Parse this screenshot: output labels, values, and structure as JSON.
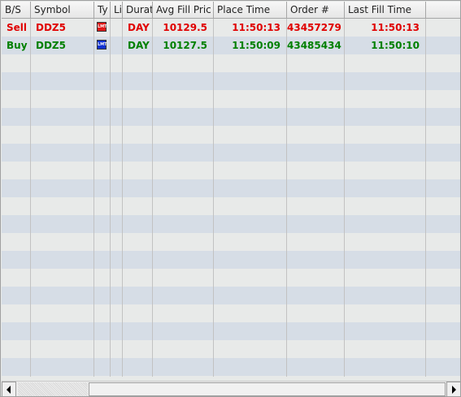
{
  "columns": [
    {
      "key": "bs",
      "label": "B/S"
    },
    {
      "key": "symbol",
      "label": "Symbol"
    },
    {
      "key": "type",
      "label": "Ty"
    },
    {
      "key": "li",
      "label": "Li"
    },
    {
      "key": "duration",
      "label": "Durat"
    },
    {
      "key": "avg_fill_price",
      "label": "Avg Fill Pric"
    },
    {
      "key": "place_time",
      "label": "Place Time"
    },
    {
      "key": "order_no",
      "label": "Order #"
    },
    {
      "key": "last_fill_time",
      "label": "Last Fill Time"
    }
  ],
  "orders": [
    {
      "bs": "Sell",
      "symbol": "DDZ5",
      "type_icon": "LMT",
      "type_icon_name": "limit-order-icon",
      "li": "",
      "duration": "DAY",
      "avg_fill_price": "10129.5",
      "place_time": "11:50:13",
      "order_no": "43457279",
      "last_fill_time": "11:50:13",
      "side": "sell"
    },
    {
      "bs": "Buy",
      "symbol": "DDZ5",
      "type_icon": "LMT",
      "type_icon_name": "limit-order-icon",
      "li": "",
      "duration": "DAY",
      "avg_fill_price": "10127.5",
      "place_time": "11:50:09",
      "order_no": "43485434",
      "last_fill_time": "11:50:10",
      "side": "buy"
    }
  ],
  "colors": {
    "sell": "#e00000",
    "buy": "#008000",
    "row_odd": "#e8eae9",
    "row_even": "#d6dde6"
  },
  "scrollbar": {
    "left_icon": "scroll-left-arrow-icon",
    "right_icon": "scroll-right-arrow-icon"
  }
}
